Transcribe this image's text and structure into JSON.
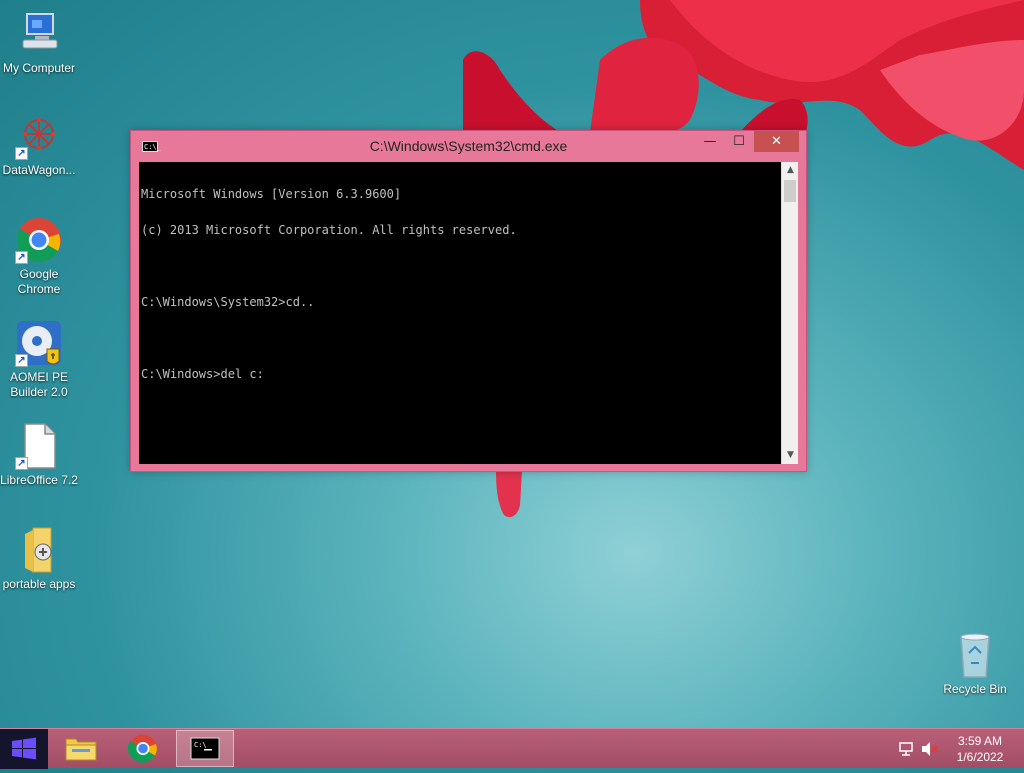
{
  "desktop": {
    "icons": [
      {
        "label": "My Computer",
        "icon": "computer-icon"
      },
      {
        "label": "DataWagon...",
        "icon": "datawagon-icon"
      },
      {
        "label": "Google Chrome",
        "icon": "chrome-icon"
      },
      {
        "label": "AOMEI PE Builder 2.0",
        "icon": "aomei-disc-icon"
      },
      {
        "label": "LibreOffice 7.2",
        "icon": "libreoffice-icon"
      },
      {
        "label": "portable apps",
        "icon": "folder-icon"
      },
      {
        "label": "Recycle Bin",
        "icon": "recycle-bin-icon"
      }
    ]
  },
  "cmd": {
    "title": "C:\\Windows\\System32\\cmd.exe",
    "icon_text": "C:\\_",
    "buttons": {
      "minimize": "—",
      "maximize": "☐",
      "close": "✕"
    },
    "lines": [
      "Microsoft Windows [Version 6.3.9600]",
      "(c) 2013 Microsoft Corporation. All rights reserved.",
      "",
      "C:\\Windows\\System32>cd..",
      "",
      "C:\\Windows>del c:"
    ]
  },
  "taskbar": {
    "pinned": [
      "start-button",
      "file-explorer",
      "google-chrome",
      "command-prompt"
    ],
    "active": "command-prompt",
    "tray": {
      "network_icon": "network-icon",
      "volume_icon": "volume-muted-icon"
    },
    "clock": {
      "time": "3:59 AM",
      "date": "1/6/2022"
    }
  },
  "colors": {
    "window_frame": "#e8789a",
    "close_button": "#c75050",
    "taskbar": "#a24d66",
    "start_button": "#14142d"
  }
}
